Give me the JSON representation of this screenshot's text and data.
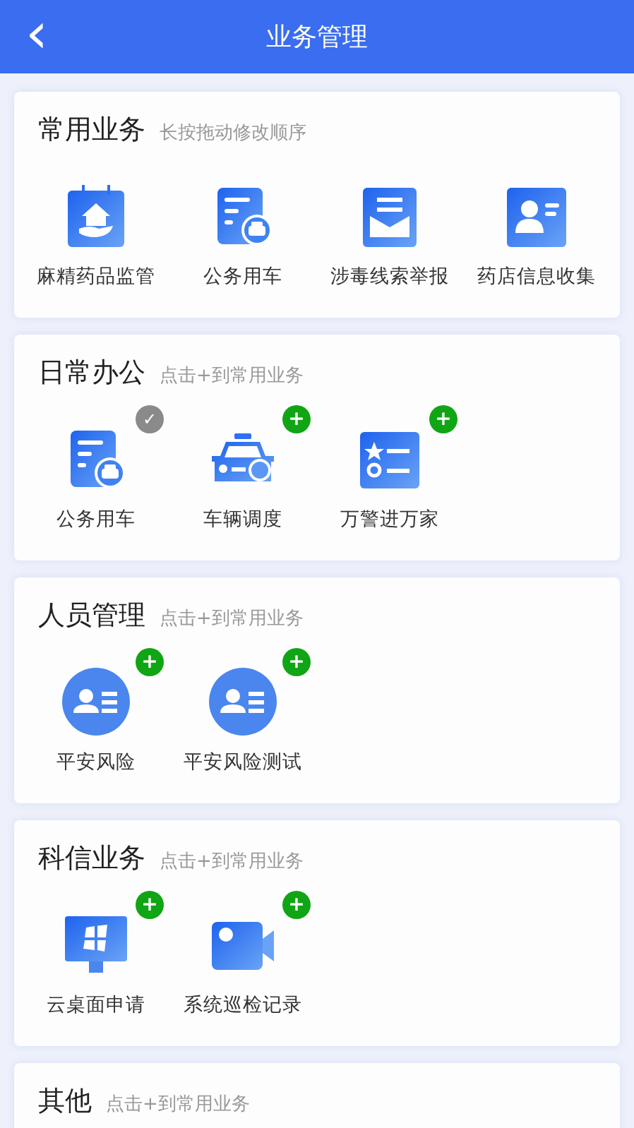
{
  "header": {
    "back": "‹",
    "title": "业务管理"
  },
  "sections": [
    {
      "title": "常用业务",
      "hint": "长按拖动修改顺序",
      "items": [
        {
          "label": "麻精药品监管",
          "kind": "house"
        },
        {
          "label": "公务用车",
          "kind": "document"
        },
        {
          "label": "涉毒线索举报",
          "kind": "envelope"
        },
        {
          "label": "药店信息收集",
          "kind": "contact"
        }
      ]
    },
    {
      "title": "日常办公",
      "hint": "点击+到常用业务",
      "items": [
        {
          "label": "公务用车",
          "kind": "document",
          "added": true,
          "badge": "✓"
        },
        {
          "label": "车辆调度",
          "kind": "taxi",
          "added": false,
          "badge": "+"
        },
        {
          "label": "万警进万家",
          "kind": "starlist",
          "added": false,
          "badge": "+"
        }
      ]
    },
    {
      "title": "人员管理",
      "hint": "点击+到常用业务",
      "items": [
        {
          "label": "平安风险",
          "kind": "person",
          "added": false,
          "badge": "+"
        },
        {
          "label": "平安风险测试",
          "kind": "person",
          "added": false,
          "badge": "+"
        }
      ]
    },
    {
      "title": "科信业务",
      "hint": "点击+到常用业务",
      "items": [
        {
          "label": "云桌面申请",
          "kind": "monitor",
          "added": false,
          "badge": "+"
        },
        {
          "label": "系统巡检记录",
          "kind": "camera",
          "added": false,
          "badge": "+"
        }
      ]
    },
    {
      "title": "其他",
      "hint": "点击+到常用业务"
    }
  ]
}
